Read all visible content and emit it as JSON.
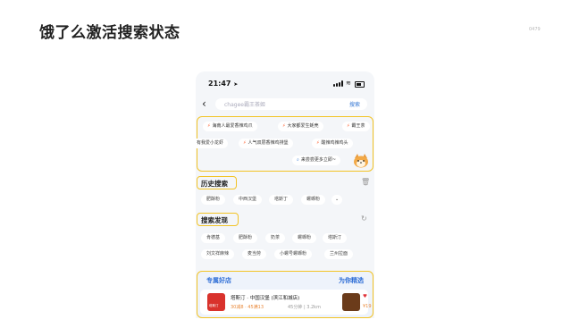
{
  "slide": {
    "title": "饿了么激活搜索状态",
    "page_number": "0479"
  },
  "status_bar": {
    "time": "21:47",
    "location_icon": "location-arrow-icon",
    "signal_icon": "signal-icon",
    "wifi_icon": "wifi-icon",
    "battery_icon": "battery-icon"
  },
  "search": {
    "back_icon": "back-chevron-icon",
    "placeholder": "chagee霸王茶姬",
    "button_label": "搜索"
  },
  "hot_searches": {
    "row1": [
      "海南人最爱香辣鸡爪",
      "大家都爱生蚝壳",
      "霸王茶"
    ],
    "row2": [
      "有我爱小龙虾",
      "人气双层香辣鸡排堡",
      "酸辣鸡辣鸡头"
    ],
    "more_label": "来尝尝更多立即~",
    "fire_icon": "fire-icon",
    "mascot_icon": "shiba-mascot-icon"
  },
  "history": {
    "title": "历史搜索",
    "items": [
      "肥酥粉",
      "中西汉堡",
      "塔斯丁",
      "螺蛳粉"
    ],
    "expand_icon": "chevron-down-icon",
    "delete_icon": "trash-icon"
  },
  "discover": {
    "title": "搜索发现",
    "refresh_icon": "refresh-icon",
    "row1": [
      "肯德基",
      "肥酥粉",
      "奶茶",
      "螺蛳粉",
      "塔斯汀"
    ],
    "row2": [
      "刘文祥麻辣",
      "麦当劳",
      "小螺号螺蛳粉",
      "兰州拉面"
    ]
  },
  "shops": {
    "title": "专属好店",
    "pick_label": "为你精选",
    "card": {
      "logo_text": "塔斯汀",
      "name": "塔斯汀 · 中国汉堡 (滨江和城店)",
      "promo": "30减8 · 45满13",
      "meta": "45分钟 | 3.2km",
      "heart": "♥",
      "price": "¥19"
    }
  },
  "colors": {
    "highlight": "#f2c326",
    "accent_blue": "#2f6ed6",
    "fire": "#ff5a2a"
  }
}
